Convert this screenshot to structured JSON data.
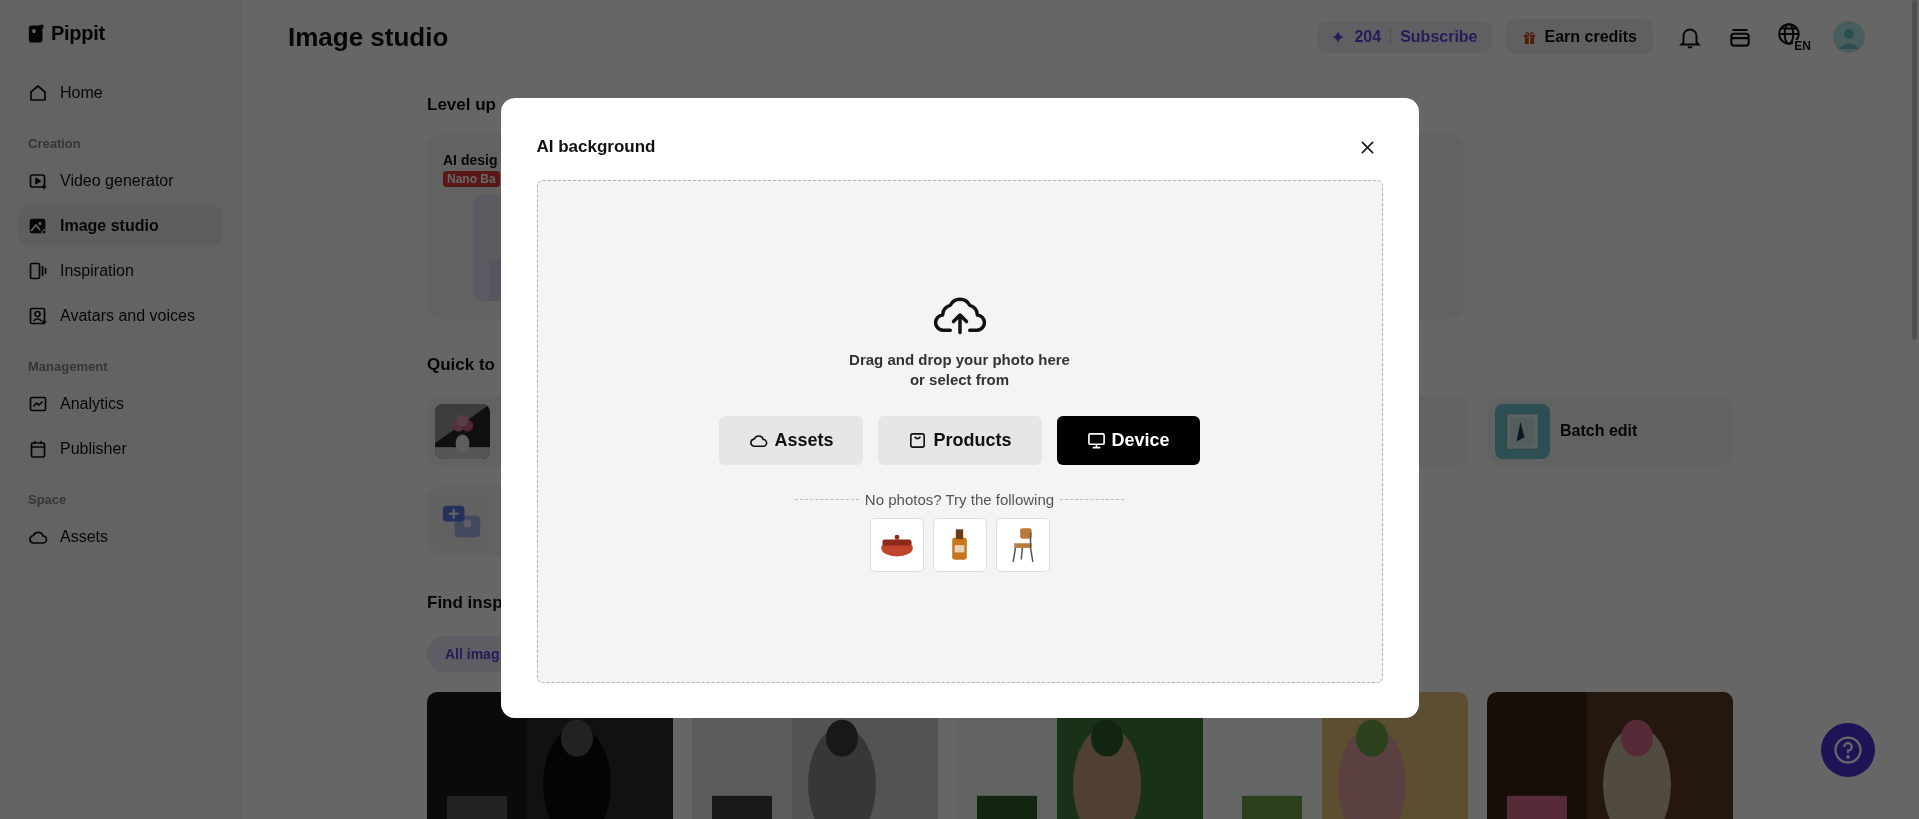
{
  "sidebar": {
    "brand": "Pippit",
    "sections": [
      {
        "items": [
          {
            "label": "Home",
            "selected": false
          }
        ]
      },
      {
        "title": "Creation",
        "items": [
          {
            "label": "Video generator",
            "selected": false
          },
          {
            "label": "Image studio",
            "selected": true
          },
          {
            "label": "Inspiration",
            "selected": false
          },
          {
            "label": "Avatars and voices",
            "selected": false
          }
        ]
      },
      {
        "title": "Management",
        "items": [
          {
            "label": "Analytics",
            "selected": false
          },
          {
            "label": "Publisher",
            "selected": false
          }
        ]
      },
      {
        "title": "Space",
        "items": [
          {
            "label": "Assets",
            "selected": false
          }
        ]
      }
    ]
  },
  "header": {
    "title": "Image studio",
    "credits": "204",
    "subscribe": "Subscribe",
    "earn": "Earn credits",
    "language": "EN"
  },
  "content": {
    "level_up": {
      "heading": "Level up",
      "card_title": "AI desig",
      "badge": "Nano Ba"
    },
    "quick_tools": {
      "heading": "Quick to",
      "tools": [
        {
          "kind": "picture"
        },
        {
          "kind": "picture",
          "label": "Batch edit"
        },
        {
          "kind": "icon"
        }
      ]
    },
    "inspiration": {
      "heading": "Find insp",
      "filter": {
        "label": "All imag",
        "selected": true
      },
      "gallery": [
        {
          "kind": "picture"
        },
        {
          "kind": "picture"
        },
        {
          "kind": "picture"
        },
        {
          "kind": "picture"
        },
        {
          "kind": "picture"
        }
      ]
    }
  },
  "dialog": {
    "title": "AI background",
    "prompt_lines": [
      "Drag and drop your photo here",
      "or select from"
    ],
    "sources": [
      {
        "label": "Assets",
        "selected": false
      },
      {
        "label": "Products",
        "selected": false
      },
      {
        "label": "Device",
        "selected": true
      }
    ],
    "samples_caption": "No photos? Try the following",
    "samples": [
      {
        "kind": "picture"
      },
      {
        "kind": "picture"
      },
      {
        "kind": "picture"
      }
    ]
  }
}
